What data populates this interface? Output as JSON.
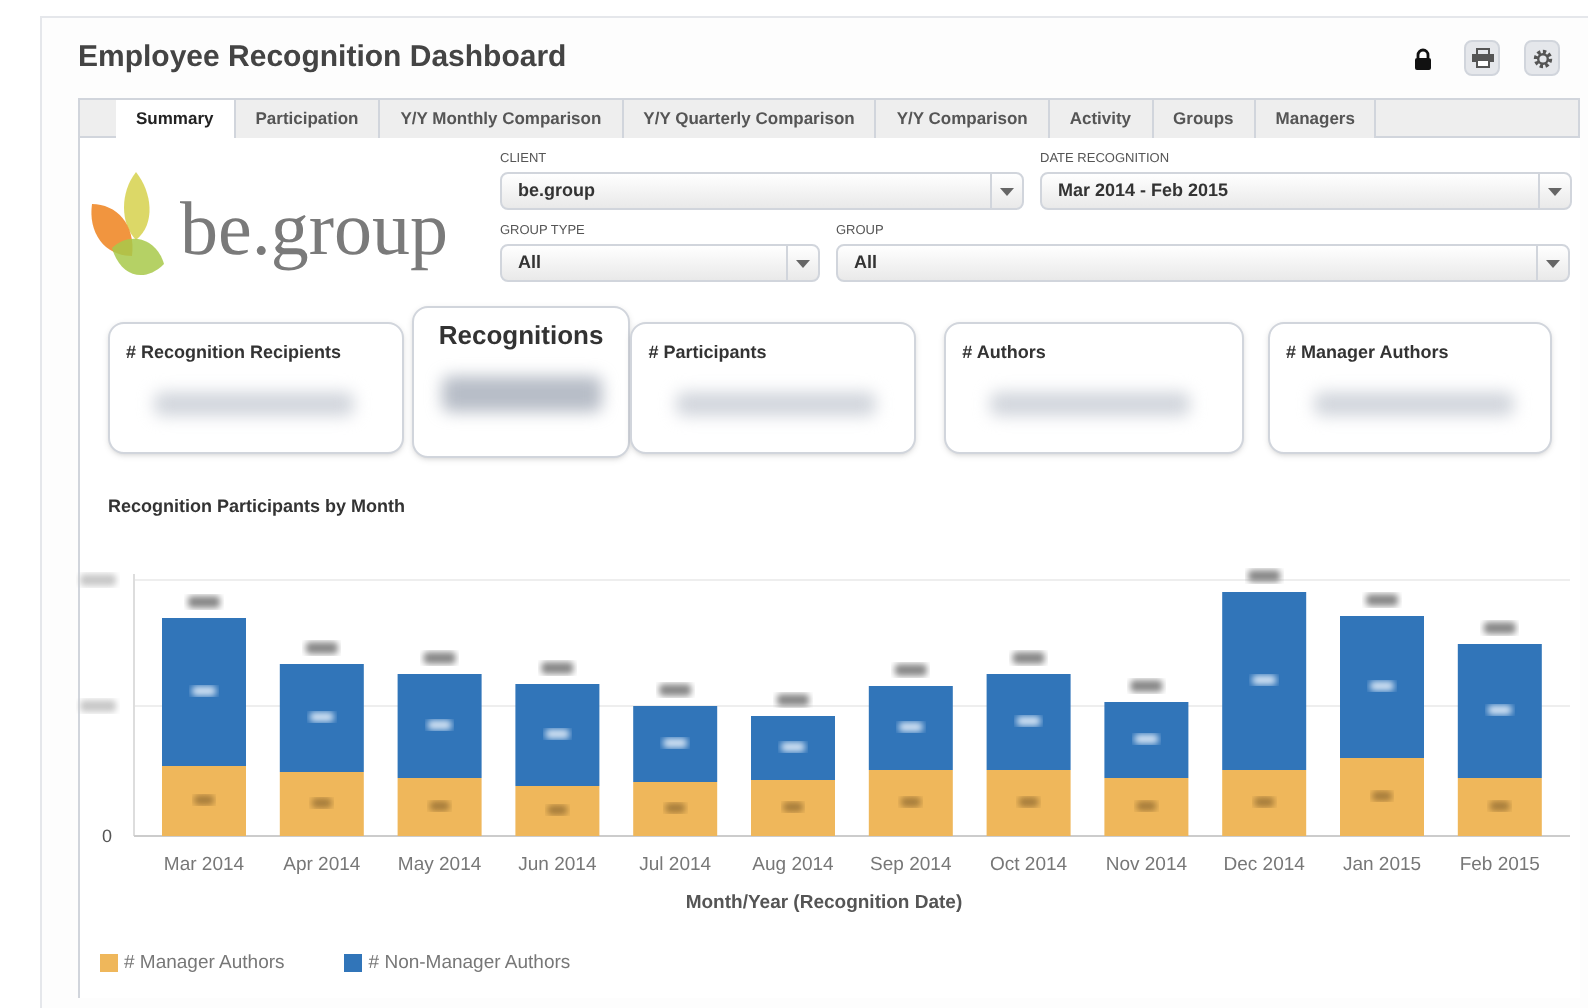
{
  "window": {
    "title": "Employee Recognition Dashboard"
  },
  "tabs": [
    {
      "label": "Summary",
      "selected": true
    },
    {
      "label": "Participation",
      "selected": false
    },
    {
      "label": "Y/Y Monthly Comparison",
      "selected": false
    },
    {
      "label": "Y/Y Quarterly Comparison",
      "selected": false
    },
    {
      "label": "Y/Y Comparison",
      "selected": false
    },
    {
      "label": "Activity",
      "selected": false
    },
    {
      "label": "Groups",
      "selected": false
    },
    {
      "label": "Managers",
      "selected": false
    }
  ],
  "logo": {
    "text": "be.group"
  },
  "filter_rows": [
    [
      {
        "label": "CLIENT",
        "value": "be.group"
      },
      {
        "label": "DATE RECOGNITION",
        "value": "Mar 2014 - Feb 2015"
      }
    ],
    [
      {
        "label": "GROUP TYPE",
        "value": "All"
      },
      {
        "label": "GROUP",
        "value": "All"
      }
    ]
  ],
  "metrics": [
    {
      "label": "# Recognition Recipients",
      "kind": "standard"
    },
    {
      "label": "Recognitions",
      "kind": "featured"
    },
    {
      "label": "# Participants",
      "kind": "standard"
    },
    {
      "label": "# Authors",
      "kind": "standard"
    },
    {
      "label": "# Manager Authors",
      "kind": "standard"
    }
  ],
  "chart": {
    "title": "Recognition Participants by Month",
    "y_tick": "0",
    "x_labels": [
      "Mar 2014",
      "Apr 2014",
      "May 2014",
      "Jun 2014",
      "Jul 2014",
      "Aug 2014",
      "Sep 2014",
      "Oct 2014",
      "Nov 2014",
      "Dec 2014",
      "Jan 2015",
      "Feb 2015"
    ],
    "axis_title": "Month/Year (Recognition Date)",
    "legend": [
      {
        "label": "# Manager Authors",
        "color": "#efb75b"
      },
      {
        "label": "# Non-Manager Authors",
        "color": "#3175b9"
      }
    ]
  }
}
